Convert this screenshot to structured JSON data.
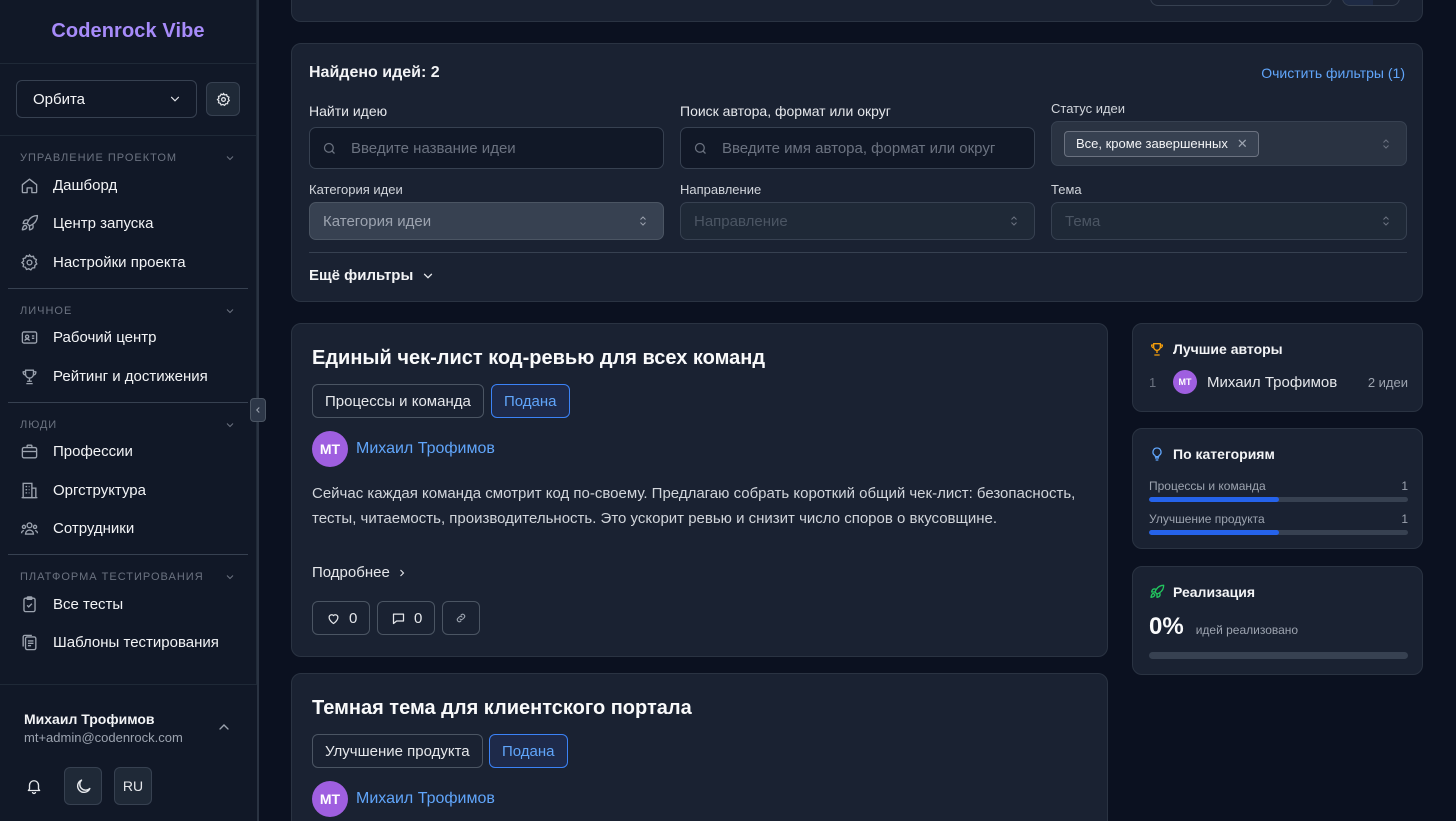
{
  "sidebar": {
    "brand": "Codenrock Vibe",
    "project": "Орбита",
    "sections": [
      {
        "title": "УПРАВЛЕНИЕ ПРОЕКТОМ",
        "items": [
          {
            "label": "Дашборд",
            "icon": "home-icon"
          },
          {
            "label": "Центр запуска",
            "icon": "rocket-icon"
          },
          {
            "label": "Настройки проекта",
            "icon": "gear-icon"
          }
        ]
      },
      {
        "title": "ЛИЧНОЕ",
        "items": [
          {
            "label": "Рабочий центр",
            "icon": "id-card-icon"
          },
          {
            "label": "Рейтинг и достижения",
            "icon": "trophy-icon"
          }
        ]
      },
      {
        "title": "ЛЮДИ",
        "items": [
          {
            "label": "Профессии",
            "icon": "briefcase-icon"
          },
          {
            "label": "Оргструктура",
            "icon": "building-icon"
          },
          {
            "label": "Сотрудники",
            "icon": "users-icon"
          }
        ]
      },
      {
        "title": "ПЛАТФОРМА ТЕСТИРОВАНИЯ",
        "items": [
          {
            "label": "Все тесты",
            "icon": "clipboard-check-icon"
          },
          {
            "label": "Шаблоны тестирования",
            "icon": "clipboard-copy-icon"
          }
        ]
      }
    ],
    "user": {
      "name": "Михаил Трофимов",
      "email": "mt+admin@codenrock.com",
      "language": "RU"
    }
  },
  "filters": {
    "found": "Найдено идей: 2",
    "clear": "Очистить фильтры (1)",
    "search_label": "Найти идею",
    "search_placeholder": "Введите название идеи",
    "author_label": "Поиск автора, формат или округ",
    "author_placeholder": "Введите имя автора, формат или округ",
    "status_label": "Статус идеи",
    "status_chip": "Все, кроме завершенных",
    "category_label": "Категория идеи",
    "category_placeholder": "Категория идеи",
    "direction_label": "Направление",
    "direction_placeholder": "Направление",
    "topic_label": "Тема",
    "topic_placeholder": "Тема",
    "more": "Ещё фильтры"
  },
  "ideas": [
    {
      "title": "Единый чек-лист код-ревью для всех команд",
      "category": "Процессы и команда",
      "status": "Подана",
      "author_initials": "МТ",
      "author": "Михаил Трофимов",
      "description": "Сейчас каждая команда смотрит код по-своему. Предлагаю собрать короткий общий чек-лист: безопасность, тесты, читаемость, производительность. Это ускорит ревью и снизит число споров о вкусовщине.",
      "more": "Подробнее",
      "likes": "0",
      "comments": "0"
    },
    {
      "title": "Темная тема для клиентского портала",
      "category": "Улучшение продукта",
      "status": "Подана",
      "author_initials": "МТ",
      "author": "Михаил Трофимов"
    }
  ],
  "leaders": {
    "title": "Лучшие авторы",
    "rows": [
      {
        "rank": "1",
        "initials": "МТ",
        "name": "Михаил Трофимов",
        "count": "2 идеи"
      }
    ]
  },
  "categories": {
    "title": "По категориям",
    "rows": [
      {
        "name": "Процессы и команда",
        "count": "1",
        "share": 0.5
      },
      {
        "name": "Улучшение продукта",
        "count": "1",
        "share": 0.5
      }
    ]
  },
  "implementation": {
    "title": "Реализация",
    "value": "0%",
    "label": "идей реализовано",
    "share": 0
  },
  "colors": {
    "accent": "#a78bfa",
    "link": "#60a5fa",
    "avatar": "#9f5fe0",
    "bar": "#2563eb"
  }
}
